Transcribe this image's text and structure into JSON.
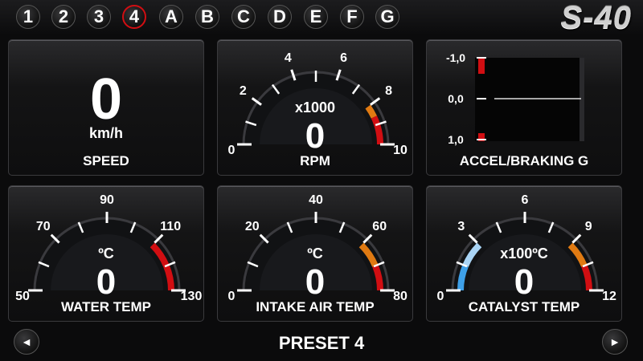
{
  "top": {
    "buttons": [
      "1",
      "2",
      "3",
      "4",
      "A",
      "B",
      "C",
      "D",
      "E",
      "F",
      "G"
    ],
    "active": "4",
    "logo": "S-40"
  },
  "speed": {
    "value": "0",
    "unit": "km/h",
    "label": "SPEED"
  },
  "rpm": {
    "value": "0",
    "unit": "x1000",
    "label": "RPM",
    "ticks": [
      "0",
      "2",
      "4",
      "6",
      "8",
      "10"
    ]
  },
  "accel": {
    "label": "ACCEL/BRAKING G",
    "ticks": [
      "-1,0",
      "0,0",
      "1,0"
    ]
  },
  "water": {
    "value": "0",
    "unit": "ºC",
    "label": "WATER TEMP",
    "ticks": [
      "50",
      "70",
      "90",
      "110",
      "130"
    ]
  },
  "intake": {
    "value": "0",
    "unit": "ºC",
    "label": "INTAKE AIR TEMP",
    "ticks": [
      "0",
      "20",
      "40",
      "60",
      "80"
    ]
  },
  "catalyst": {
    "value": "0",
    "unit": "x100ºC",
    "label": "CATALYST TEMP",
    "ticks": [
      "0",
      "3",
      "6",
      "9",
      "12"
    ]
  },
  "bottom": {
    "title": "PRESET 4",
    "prev_icon": "◄",
    "next_icon": "►"
  },
  "colors": {
    "red": "#d10e12",
    "orange": "#e07a12",
    "blue": "#3ea0e8",
    "lightblue": "#a9d4f5"
  }
}
